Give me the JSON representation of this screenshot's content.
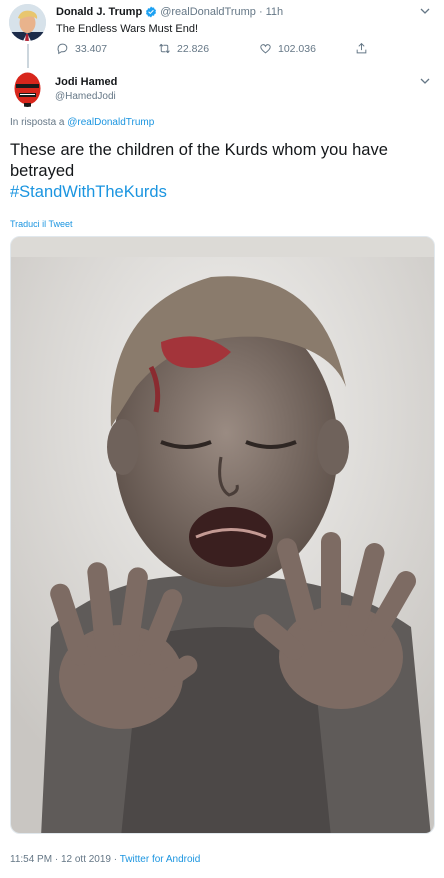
{
  "parent_tweet": {
    "name": "Donald J. Trump",
    "handle": "@realDonaldTrump",
    "separator": "·",
    "time": "11h",
    "text": "The Endless Wars Must End!",
    "replies": "33.407",
    "retweets": "22.826",
    "likes": "102.036"
  },
  "tweet": {
    "name": "Jodi Hamed",
    "handle": "@HamedJodi",
    "reply_prefix": "In risposta a",
    "reply_to": "@realDonaldTrump",
    "text": "These are the children of the Kurds whom you have betrayed",
    "hashtag": "#StandWithTheKurds",
    "translate": "Traduci il Tweet",
    "timestamp": "11:54 PM · 12 ott 2019 ·",
    "source": "Twitter for Android"
  },
  "colors": {
    "link": "#1b95e0",
    "muted": "#657786",
    "text": "#14171a",
    "avatar_jodi": "#d8261c"
  },
  "icons": [
    "verified-badge-icon",
    "reply-icon",
    "retweet-icon",
    "like-icon",
    "share-icon",
    "chevron-down-icon"
  ]
}
